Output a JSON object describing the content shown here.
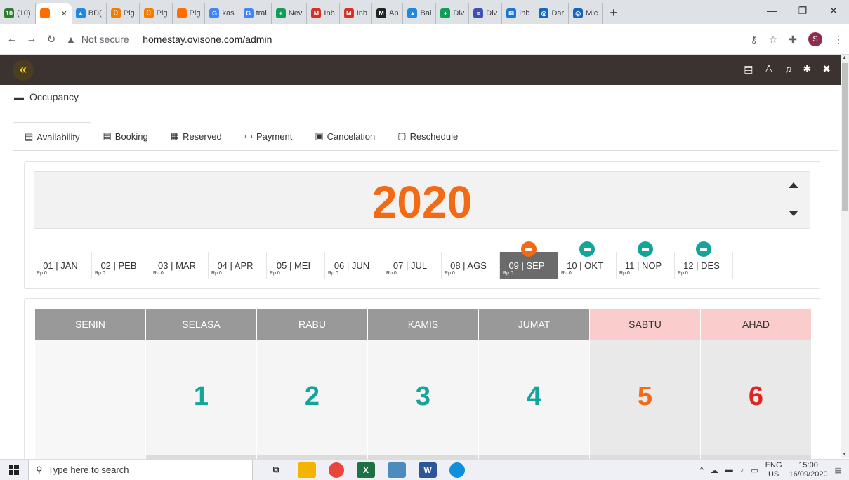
{
  "browser": {
    "tabs": [
      {
        "label": "(10)",
        "favicon_color": "#2e7d32",
        "favicon_text": "10"
      },
      {
        "label": "",
        "favicon_color": "#ff6d00",
        "favicon_text": "",
        "active": true
      },
      {
        "label": "BD(",
        "favicon_color": "#1e88e5",
        "favicon_text": "▲"
      },
      {
        "label": "Pig",
        "favicon_color": "#f57c00",
        "favicon_text": "Ü"
      },
      {
        "label": "Pig",
        "favicon_color": "#f57c00",
        "favicon_text": "Ü"
      },
      {
        "label": "Pig",
        "favicon_color": "#ff6d00",
        "favicon_text": ""
      },
      {
        "label": "kas",
        "favicon_color": "#4285f4",
        "favicon_text": "G"
      },
      {
        "label": "trai",
        "favicon_color": "#4285f4",
        "favicon_text": "G"
      },
      {
        "label": "Nev",
        "favicon_color": "#0f9d58",
        "favicon_text": "+"
      },
      {
        "label": "Inb",
        "favicon_color": "#d93025",
        "favicon_text": "M"
      },
      {
        "label": "Inb",
        "favicon_color": "#d93025",
        "favicon_text": "M"
      },
      {
        "label": "Ap",
        "favicon_color": "#222222",
        "favicon_text": "M"
      },
      {
        "label": "Bal",
        "favicon_color": "#1e88e5",
        "favicon_text": "▲"
      },
      {
        "label": "Div",
        "favicon_color": "#0f9d58",
        "favicon_text": "+"
      },
      {
        "label": "Div",
        "favicon_color": "#3f51b5",
        "favicon_text": "≡"
      },
      {
        "label": "Inb",
        "favicon_color": "#1976d2",
        "favicon_text": "✉"
      },
      {
        "label": "Dar",
        "favicon_color": "#1565c0",
        "favicon_text": "◎"
      },
      {
        "label": "Mic",
        "favicon_color": "#1565c0",
        "favicon_text": "◎"
      }
    ],
    "new_tab": "+",
    "url_security": "Not secure",
    "url_host": "homestay.ovisone.com/admin",
    "profile_initial": "S"
  },
  "app": {
    "collapse_icon": "«",
    "page_title": "Occupancy",
    "tabs": [
      {
        "label": "Availability",
        "icon": "▤"
      },
      {
        "label": "Booking",
        "icon": "▤"
      },
      {
        "label": "Reserved",
        "icon": "▦"
      },
      {
        "label": "Payment",
        "icon": "▭"
      },
      {
        "label": "Cancelation",
        "icon": "▣"
      },
      {
        "label": "Reschedule",
        "icon": "▢"
      }
    ],
    "year": "2020",
    "months": [
      {
        "label": "01 | JAN",
        "price": "Rp.0",
        "badge": ""
      },
      {
        "label": "02 | PEB",
        "price": "Rp.0",
        "badge": ""
      },
      {
        "label": "03 | MAR",
        "price": "Rp.0",
        "badge": ""
      },
      {
        "label": "04 | APR",
        "price": "Rp.0",
        "badge": ""
      },
      {
        "label": "05 | MEI",
        "price": "Rp.0",
        "badge": ""
      },
      {
        "label": "06 | JUN",
        "price": "Rp.0",
        "badge": ""
      },
      {
        "label": "07 | JUL",
        "price": "Rp.0",
        "badge": ""
      },
      {
        "label": "08 | AGS",
        "price": "Rp.0",
        "badge": ""
      },
      {
        "label": "09 | SEP",
        "price": "Rp.0",
        "badge": "orange",
        "selected": true
      },
      {
        "label": "10 | OKT",
        "price": "Rp.0",
        "badge": "teal"
      },
      {
        "label": "11 | NOP",
        "price": "Rp.0",
        "badge": "teal"
      },
      {
        "label": "12 | DES",
        "price": "Rp.0",
        "badge": "teal"
      }
    ],
    "days": [
      {
        "label": "SENIN",
        "weekend": false,
        "date": "",
        "color": ""
      },
      {
        "label": "SELASA",
        "weekend": false,
        "date": "1",
        "color": "#14a49a"
      },
      {
        "label": "RABU",
        "weekend": false,
        "date": "2",
        "color": "#14a49a"
      },
      {
        "label": "KAMIS",
        "weekend": false,
        "date": "3",
        "color": "#14a49a"
      },
      {
        "label": "JUMAT",
        "weekend": false,
        "date": "4",
        "color": "#14a49a"
      },
      {
        "label": "SABTU",
        "weekend": true,
        "date": "5",
        "color": "#f26a13"
      },
      {
        "label": "AHAD",
        "weekend": true,
        "date": "6",
        "color": "#e02424"
      }
    ]
  },
  "taskbar": {
    "search_placeholder": "Type here to search",
    "lang_top": "ENG",
    "lang_bottom": "US",
    "time": "15:00",
    "date": "16/09/2020"
  }
}
